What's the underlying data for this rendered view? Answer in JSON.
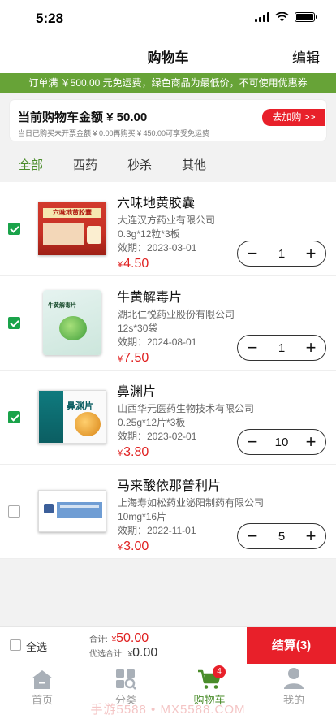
{
  "status": {
    "time": "5:28"
  },
  "nav": {
    "title": "购物车",
    "edit": "编辑"
  },
  "promo": {
    "text": "订单满 ￥500.00 元免运费，绿色商品为最低价，不可使用优惠券"
  },
  "summary": {
    "main": "当前购物车金额 ¥ 50.00",
    "sub": "当日已购买未开票金额 ¥ 0.00再购买 ¥ 450.00可享受免运费",
    "add_button": "去加购 >>"
  },
  "filters": [
    "全部",
    "西药",
    "秒杀",
    "其他"
  ],
  "items": [
    {
      "name": "六味地黄胶囊",
      "maker": "大连汉方药业有限公司",
      "spec": "0.3g*12粒*3板",
      "expiry": "效期：2023-03-01",
      "price": "4.50",
      "qty": "1",
      "checked": true,
      "image": "box-red",
      "box_text": "六味地黄胶囊"
    },
    {
      "name": "牛黄解毒片",
      "maker": "湖北仁悦药业股份有限公司",
      "spec": "12s*30袋",
      "expiry": "效期：2024-08-01",
      "price": "7.50",
      "qty": "1",
      "checked": true,
      "image": "bag",
      "box_text": "牛黄解毒片"
    },
    {
      "name": "鼻渊片",
      "maker": "山西华元医药生物技术有限公司",
      "spec": "0.25g*12片*3板",
      "expiry": "效期：2023-02-01",
      "price": "3.80",
      "qty": "10",
      "checked": true,
      "image": "box-white",
      "box_text": "鼻渊片"
    },
    {
      "name": "马来酸依那普利片",
      "maker": "上海寿如松药业泌阳制药有限公司",
      "spec": "10mg*16片",
      "expiry": "效期：2022-11-01",
      "price": "3.00",
      "qty": "5",
      "checked": false,
      "image": "box-plain",
      "box_text": ""
    }
  ],
  "checkout": {
    "select_all": "全选",
    "total_label": "合计:",
    "total_value": "50.00",
    "discount_label": "优选合计:",
    "discount_value": "0.00",
    "button": "结算(3)"
  },
  "tabs": [
    {
      "label": "首页",
      "icon": "home-icon"
    },
    {
      "label": "分类",
      "icon": "category-icon"
    },
    {
      "label": "购物车",
      "icon": "cart-icon",
      "badge": "4",
      "active": true
    },
    {
      "label": "我的",
      "icon": "profile-icon"
    }
  ],
  "watermark": "手游5588 • MX5588.COM",
  "colors": {
    "brand_green": "#67a337",
    "accent_red": "#e8202a",
    "price_red": "#e02020",
    "active_tab": "#4a8c2a",
    "check_green": "#1aa34a"
  }
}
